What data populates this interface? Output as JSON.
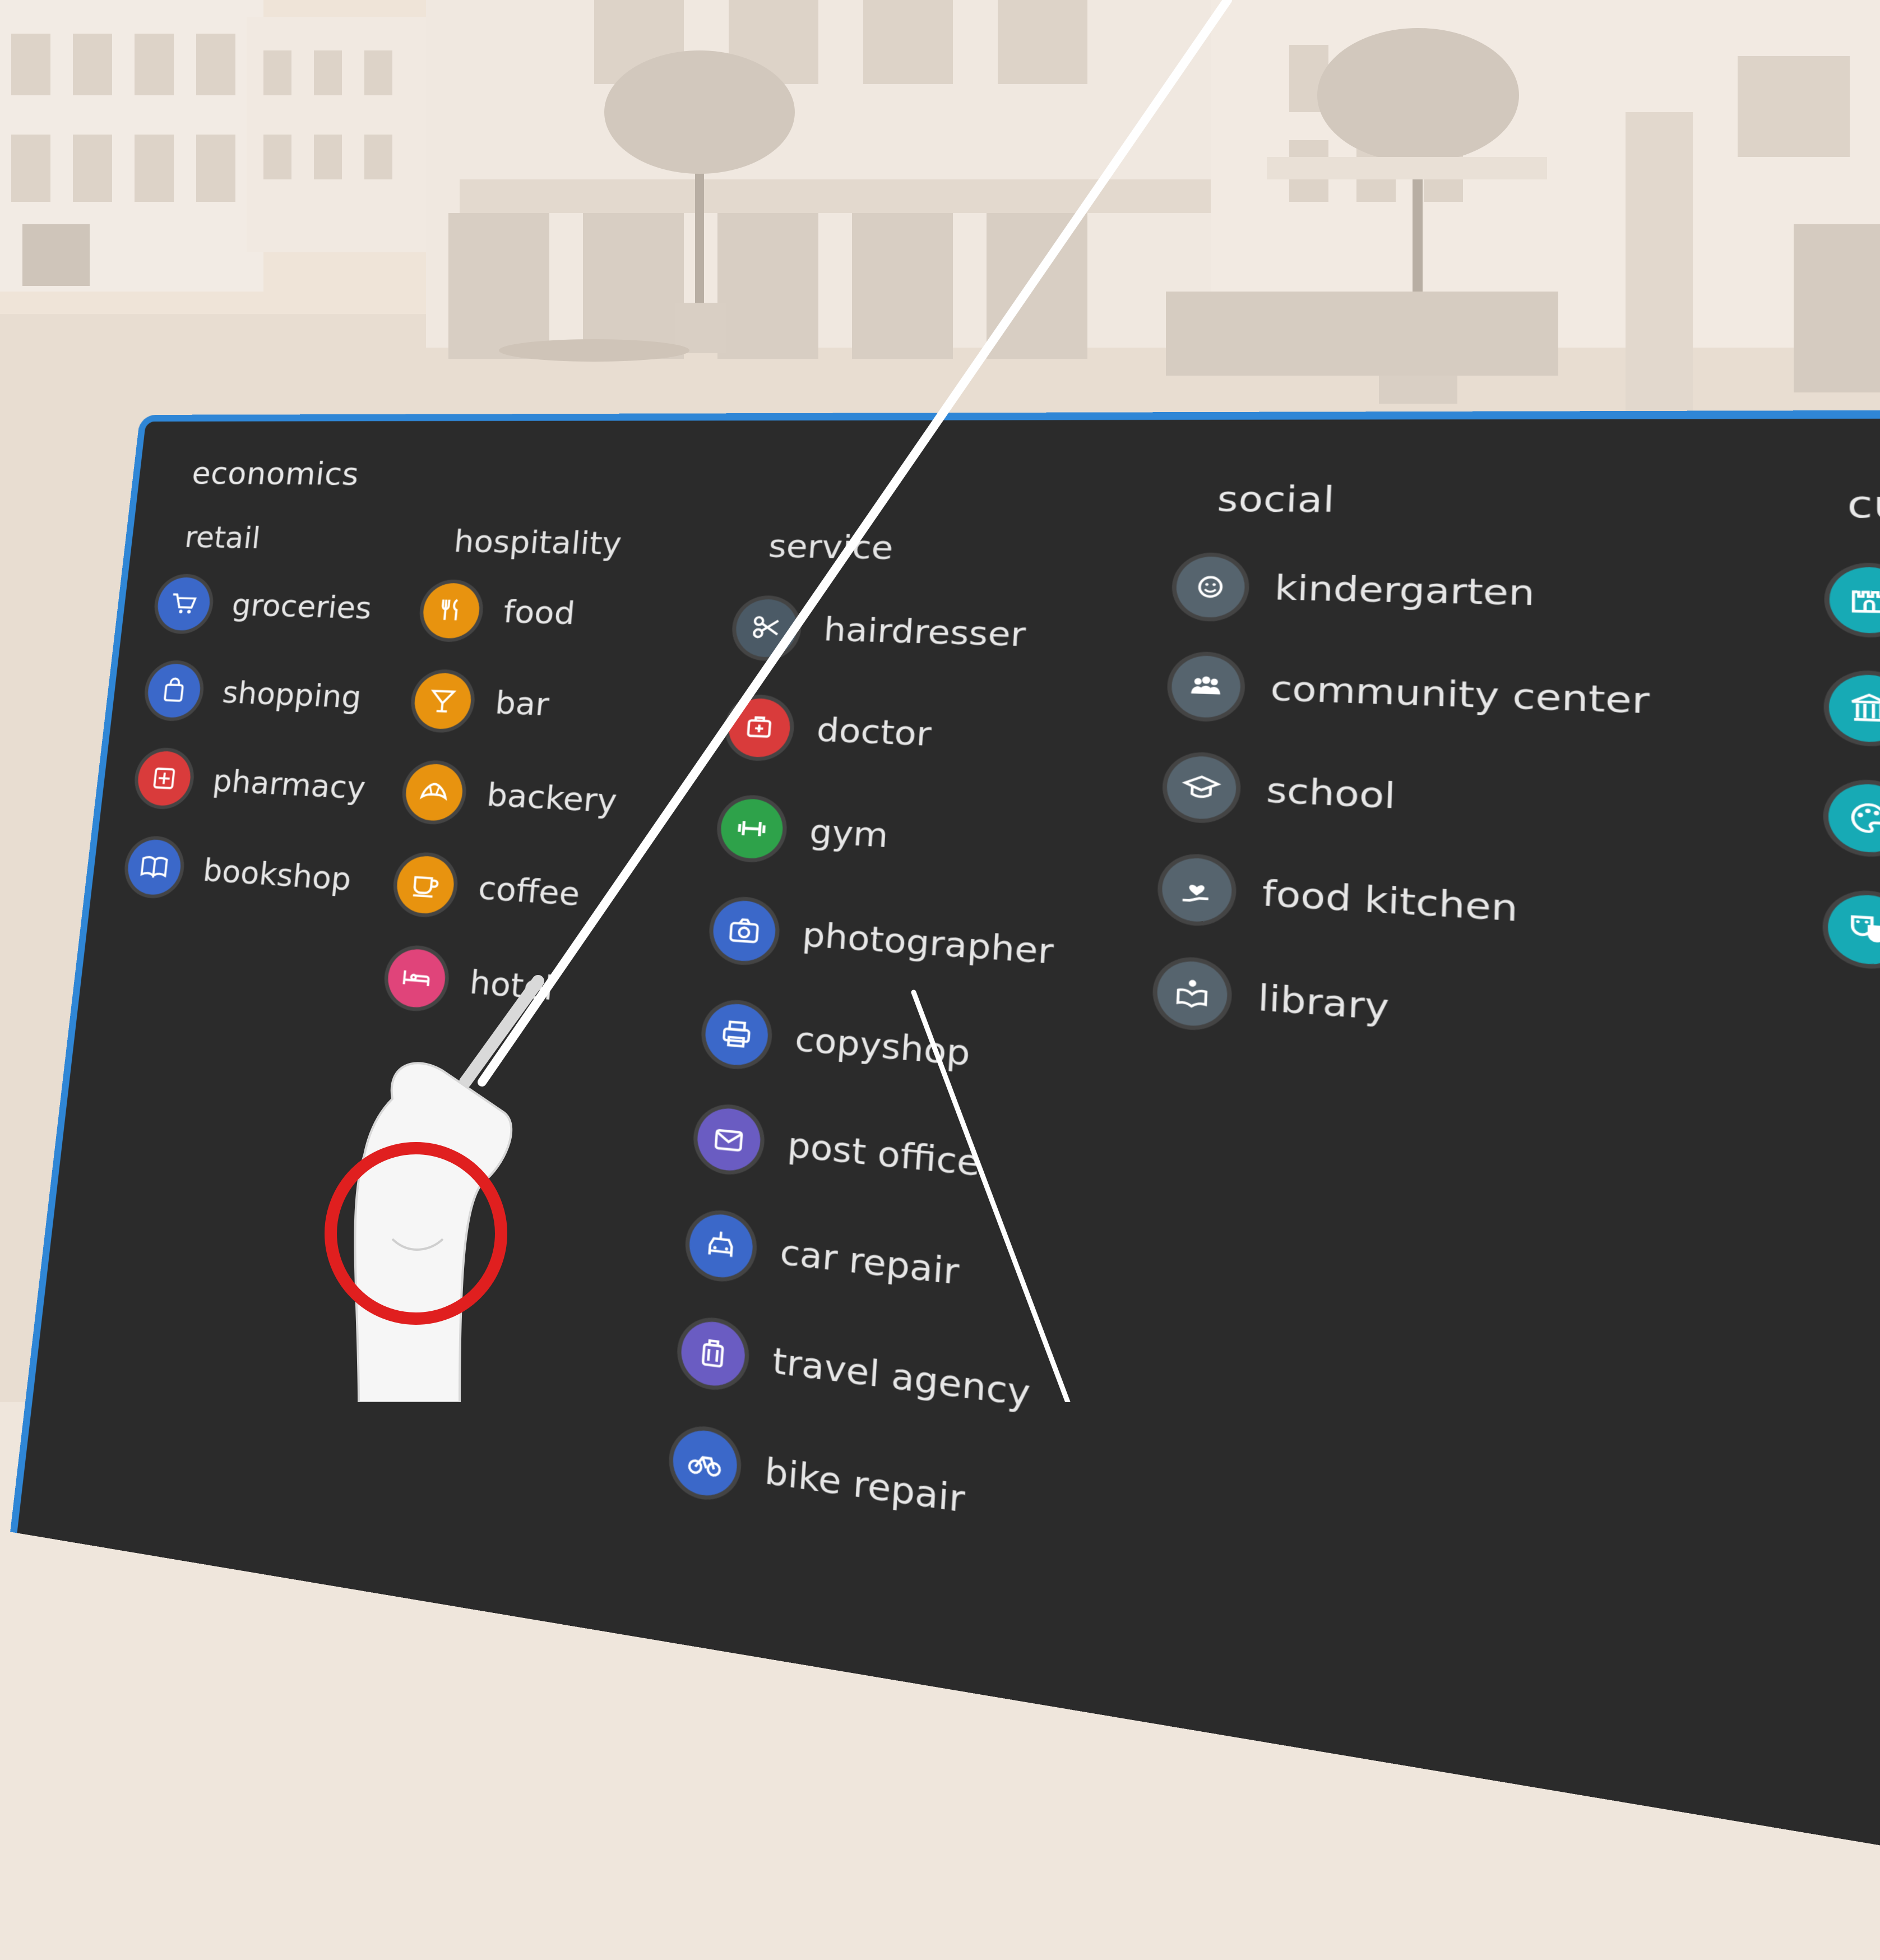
{
  "panel": {
    "heading": "economics",
    "accent_color": "#2f86d6",
    "background_color": "#2b2b2b"
  },
  "columns": {
    "retail": {
      "title": "retail",
      "items": [
        {
          "label": "groceries",
          "icon": "cart-icon",
          "color": "#3b68c9"
        },
        {
          "label": "shopping",
          "icon": "bag-icon",
          "color": "#3b68c9"
        },
        {
          "label": "pharmacy",
          "icon": "pharmacy-icon",
          "color": "#d93b3b"
        },
        {
          "label": "bookshop",
          "icon": "book-icon",
          "color": "#3b68c9"
        }
      ]
    },
    "hospitality": {
      "title": "hospitality",
      "items": [
        {
          "label": "food",
          "icon": "cutlery-icon",
          "color": "#e8930f"
        },
        {
          "label": "bar",
          "icon": "cocktail-icon",
          "color": "#e8930f"
        },
        {
          "label": "backery",
          "icon": "croissant-icon",
          "color": "#e8930f"
        },
        {
          "label": "coffee",
          "icon": "coffee-cup-icon",
          "color": "#e8930f"
        },
        {
          "label": "hotel",
          "icon": "bed-icon",
          "color": "#e0447a"
        }
      ]
    },
    "service": {
      "title": "service",
      "items": [
        {
          "label": "hairdresser",
          "icon": "scissors-icon",
          "color": "#4b5a66"
        },
        {
          "label": "doctor",
          "icon": "medical-icon",
          "color": "#d93b3b"
        },
        {
          "label": "gym",
          "icon": "dumbbell-icon",
          "color": "#2ea24a"
        },
        {
          "label": "photographer",
          "icon": "camera-icon",
          "color": "#3b68c9"
        },
        {
          "label": "copyshop",
          "icon": "printer-icon",
          "color": "#3b68c9"
        },
        {
          "label": "post office",
          "icon": "mail-icon",
          "color": "#6a5cc2"
        },
        {
          "label": "car repair",
          "icon": "car-wrench-icon",
          "color": "#3b68c9"
        },
        {
          "label": "travel agency",
          "icon": "suitcase-icon",
          "color": "#6a5cc2"
        },
        {
          "label": "bike repair",
          "icon": "bicycle-icon",
          "color": "#3b68c9"
        }
      ]
    },
    "social": {
      "title": "social",
      "items": [
        {
          "label": "kindergarten",
          "icon": "smiley-icon",
          "color": "#56646e"
        },
        {
          "label": "community center",
          "icon": "people-icon",
          "color": "#56646e"
        },
        {
          "label": "school",
          "icon": "graduation-cap-icon",
          "color": "#56646e"
        },
        {
          "label": "food kitchen",
          "icon": "hand-heart-icon",
          "color": "#56646e"
        },
        {
          "label": "library",
          "icon": "reading-icon",
          "color": "#56646e"
        }
      ]
    },
    "cultural": {
      "title": "cultural",
      "items": [
        {
          "label": "castle",
          "icon": "castle-icon",
          "color": "#17aab5"
        },
        {
          "label": "museum",
          "icon": "museum-icon",
          "color": "#17aab5"
        },
        {
          "label": "gallery",
          "icon": "palette-icon",
          "color": "#17aab5"
        },
        {
          "label": "theatre club",
          "icon": "theatre-masks-icon",
          "color": "#17aab5"
        }
      ]
    }
  },
  "overlay": {
    "highlight_ring_color": "#e01f1f",
    "pointer_ray_color": "#ffffff"
  }
}
